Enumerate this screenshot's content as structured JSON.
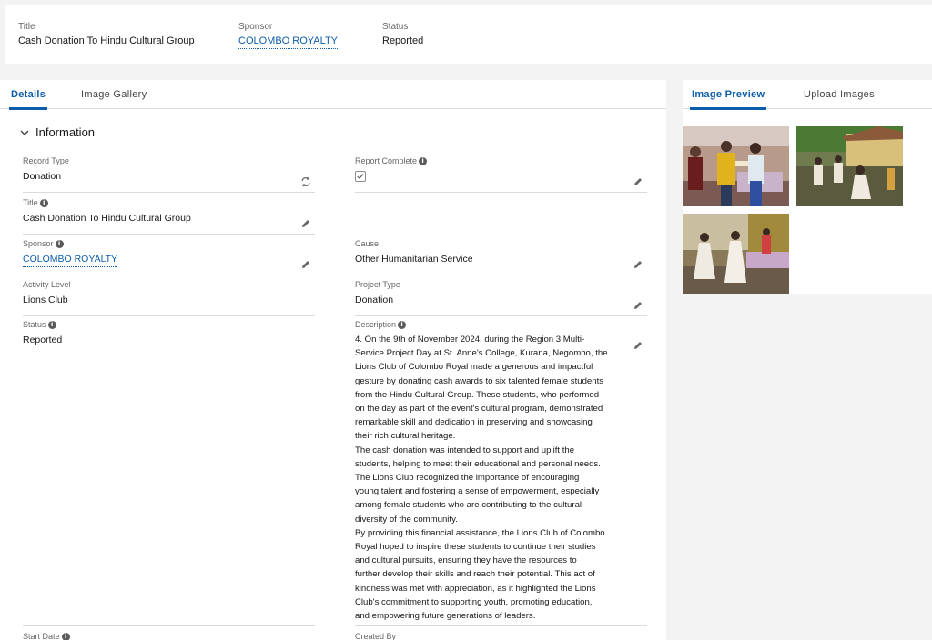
{
  "header": {
    "title_label": "Title",
    "title_value": "Cash Donation To Hindu Cultural Group",
    "sponsor_label": "Sponsor",
    "sponsor_value": "COLOMBO ROYALTY",
    "status_label": "Status",
    "status_value": "Reported"
  },
  "left_tabs": [
    "Details",
    "Image Gallery"
  ],
  "right_tabs": [
    "Image Preview",
    "Upload Images"
  ],
  "section": {
    "title": "Information"
  },
  "fields": {
    "record_type": {
      "label": "Record Type",
      "value": "Donation"
    },
    "report_complete": {
      "label": "Report Complete",
      "checked": true
    },
    "title": {
      "label": "Title",
      "value": "Cash Donation To Hindu Cultural Group"
    },
    "sponsor": {
      "label": "Sponsor",
      "value": "COLOMBO ROYALTY"
    },
    "cause": {
      "label": "Cause",
      "value": "Other Humanitarian Service"
    },
    "activity_level": {
      "label": "Activity Level",
      "value": "Lions Club"
    },
    "project_type": {
      "label": "Project Type",
      "value": "Donation"
    },
    "status": {
      "label": "Status",
      "value": "Reported"
    },
    "description": {
      "label": "Description",
      "lines": [
        "4. On the 9th of November 2024, during the Region 3 Multi-",
        "Service Project Day at St. Anne's College, Kurana, Negombo, the",
        "Lions Club of Colombo Royal made a generous and impactful",
        "gesture by donating cash awards to six talented female students",
        "from the Hindu Cultural Group. These students, who performed",
        "on the day as part of the event's cultural program, demonstrated",
        "remarkable skill and dedication in preserving and showcasing",
        "their rich cultural heritage.",
        "The cash donation was intended to support and uplift the",
        "students, helping to meet their educational and personal needs.",
        "The Lions Club recognized the importance of encouraging",
        "young talent and fostering a sense of empowerment, especially",
        "among female students who are contributing to the cultural",
        "diversity of the community.",
        "By providing this financial assistance, the Lions Club of Colombo",
        "Royal hoped to inspire these students to continue their studies",
        "and cultural pursuits, ensuring they have the resources to",
        "further develop their skills and reach their potential. This act of",
        "kindness was met with appreciation, as it highlighted the Lions",
        "Club's commitment to supporting youth, promoting education,",
        "and empowering future generations of leaders."
      ]
    },
    "start_date": {
      "label": "Start Date"
    },
    "created_by": {
      "label": "Created By"
    }
  },
  "icons": {
    "info": "info-icon",
    "edit": "pencil-icon",
    "change_record_type": "swap-icon",
    "section_toggle": "chevron-down-icon"
  },
  "colors": {
    "accent": "#0b5cab",
    "link": "#0b5cab"
  }
}
